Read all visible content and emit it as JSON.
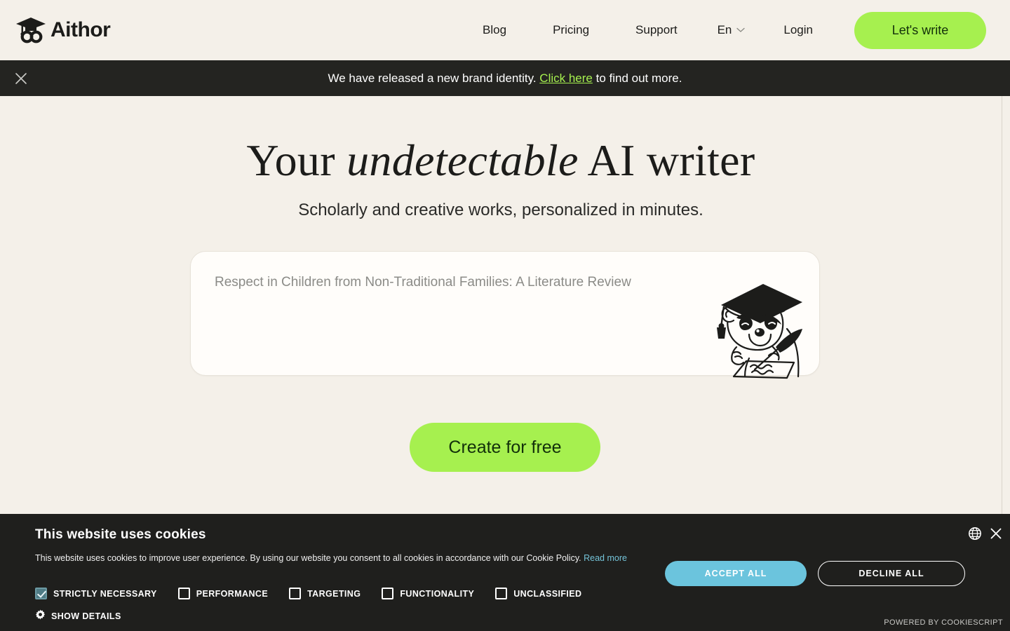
{
  "brand": {
    "name": "Aithor",
    "logo_icon": "graduation-cap-infinity-icon"
  },
  "colors": {
    "page_bg": "#f4f0e9",
    "accent_green": "#a6f04f",
    "accent_green_text": "#12300a",
    "dark": "#1f1f1d",
    "banner_dark": "#242421",
    "cookie_accept": "#6bc4dd",
    "cookie_link": "#74c3d8"
  },
  "header": {
    "nav": [
      {
        "label": "Blog",
        "name": "nav-blog"
      },
      {
        "label": "Pricing",
        "name": "nav-pricing"
      },
      {
        "label": "Support",
        "name": "nav-support"
      }
    ],
    "language": {
      "label": "En",
      "icon": "chevron-down-icon"
    },
    "login_label": "Login",
    "cta_label": "Let's write"
  },
  "announcement": {
    "close_icon": "close-icon",
    "text_before": "We have released a new brand identity. ",
    "link_label": "Click here",
    "text_after": " to find out more."
  },
  "hero": {
    "headline_part1": "Your ",
    "headline_italic": "undetectable",
    "headline_part2": " AI writer",
    "subheadline": "Scholarly and creative works, personalized in minutes.",
    "prompt_placeholder": "Respect in Children from Non-Traditional Families: A Literature Review",
    "prompt_value": "",
    "mascot_icon": "raccoon-graduate-writing-icon",
    "cta_label": "Create for free"
  },
  "cookie": {
    "title": "This website uses cookies",
    "description": "This website uses cookies to improve user experience. By using our website you consent to all cookies in accordance with our Cookie Policy. ",
    "read_more_label": "Read more",
    "categories": [
      {
        "label": "STRICTLY NECESSARY",
        "checked": true,
        "name": "cookie-category-strictly-necessary"
      },
      {
        "label": "PERFORMANCE",
        "checked": false,
        "name": "cookie-category-performance"
      },
      {
        "label": "TARGETING",
        "checked": false,
        "name": "cookie-category-targeting"
      },
      {
        "label": "FUNCTIONALITY",
        "checked": false,
        "name": "cookie-category-functionality"
      },
      {
        "label": "UNCLASSIFIED",
        "checked": false,
        "name": "cookie-category-unclassified"
      }
    ],
    "show_details_label": "SHOW DETAILS",
    "show_details_icon": "gear-icon",
    "accept_label": "ACCEPT ALL",
    "decline_label": "DECLINE ALL",
    "globe_icon": "globe-icon",
    "close_icon": "close-icon",
    "powered_by": "POWERED BY COOKIESCRIPT"
  }
}
